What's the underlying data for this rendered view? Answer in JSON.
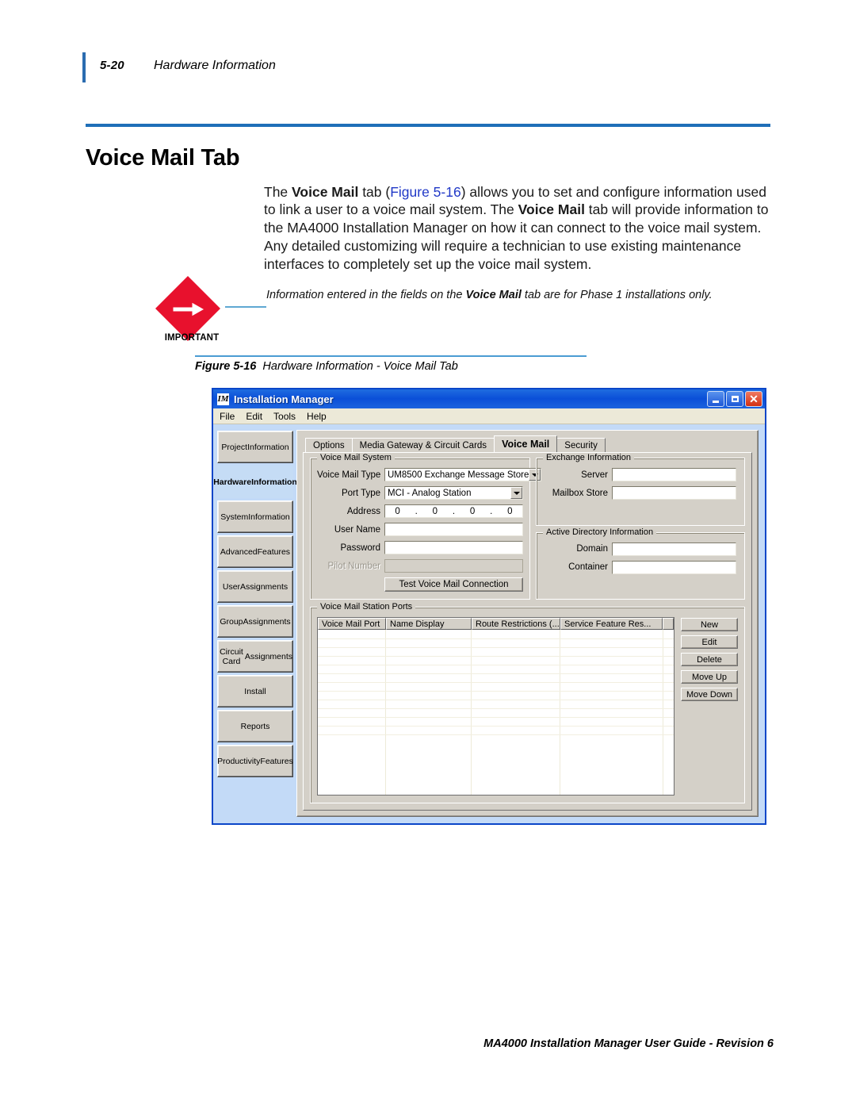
{
  "running_header": {
    "page_number": "5-20",
    "section": "Hardware Information"
  },
  "page_title": "Voice Mail Tab",
  "body_paragraph": {
    "p1_a": "The ",
    "p1_b1": "Voice Mail",
    "p1_c": " tab (",
    "p1_ref": "Figure 5-16",
    "p1_d": ") allows you to set and configure information used to link a user to a voice mail system. The ",
    "p1_b2": "Voice Mail",
    "p1_e": " tab will provide information to the MA4000 Installation Manager on how it can connect to the voice mail system. Any detailed customizing will require a technician to use existing maintenance interfaces to completely set up the voice mail system."
  },
  "important_note": {
    "label": "IMPORTANT",
    "text_a": "Information entered in the fields on the ",
    "text_b": "Voice Mail",
    "text_c": " tab are for Phase 1 installations only."
  },
  "figure_caption": {
    "number": "Figure 5-16",
    "text": "Hardware Information - Voice Mail Tab"
  },
  "app": {
    "title": "Installation Manager",
    "icon_text": "IM",
    "window_buttons": [
      "minimize",
      "maximize",
      "close"
    ],
    "menu": [
      "File",
      "Edit",
      "Tools",
      "Help"
    ],
    "sidebar": [
      {
        "label": "Project\nInformation",
        "selected": false
      },
      {
        "label": "Hardware\nInformation",
        "selected": true
      },
      {
        "label": "System\nInformation",
        "selected": false
      },
      {
        "label": "Advanced\nFeatures",
        "selected": false
      },
      {
        "label": "User\nAssignments",
        "selected": false
      },
      {
        "label": "Group\nAssignments",
        "selected": false
      },
      {
        "label": "Circuit Card\nAssignments",
        "selected": false
      },
      {
        "label": "Install",
        "selected": false
      },
      {
        "label": "Reports",
        "selected": false
      },
      {
        "label": "Productivity\nFeatures",
        "selected": false
      }
    ],
    "tabs": [
      {
        "label": "Options",
        "active": false
      },
      {
        "label": "Media Gateway & Circuit Cards",
        "active": false
      },
      {
        "label": "Voice Mail",
        "active": true
      },
      {
        "label": "Security",
        "active": false
      }
    ],
    "voice_mail_system": {
      "legend": "Voice Mail System",
      "voice_mail_type": {
        "label": "Voice Mail Type",
        "value": "UM8500 Exchange Message Store"
      },
      "port_type": {
        "label": "Port Type",
        "value": "MCI - Analog Station"
      },
      "address": {
        "label": "Address",
        "octets": [
          "0",
          "0",
          "0",
          "0"
        ],
        "separator": "."
      },
      "user_name": {
        "label": "User Name",
        "value": ""
      },
      "password": {
        "label": "Password",
        "value": ""
      },
      "pilot_number": {
        "label": "Pilot Number",
        "value": "",
        "disabled": true
      },
      "test_button": "Test Voice Mail Connection"
    },
    "exchange_information": {
      "legend": "Exchange Information",
      "fields": [
        {
          "label": "Server",
          "value": ""
        },
        {
          "label": "Mailbox Store",
          "value": ""
        }
      ]
    },
    "active_directory_information": {
      "legend": "Active Directory Information",
      "fields": [
        {
          "label": "Domain",
          "value": ""
        },
        {
          "label": "Container",
          "value": ""
        }
      ]
    },
    "station_ports": {
      "legend": "Voice Mail Station Ports",
      "columns": [
        "Voice Mail Port",
        "Name Display",
        "Route Restrictions (...",
        "Service Feature Res..."
      ],
      "rows": [],
      "buttons": [
        "New",
        "Edit",
        "Delete",
        "Move Up",
        "Move Down"
      ]
    }
  },
  "footer": "MA4000 Installation Manager User Guide - Revision 6",
  "colors": {
    "accent_blue": "#1F6FB8",
    "link_blue": "#2139C7",
    "titlebar_blue": "#0B4FD8",
    "important_red": "#E8112D",
    "dialog_face": "#D4D0C8",
    "selected_nav": "#C5DCF5"
  }
}
